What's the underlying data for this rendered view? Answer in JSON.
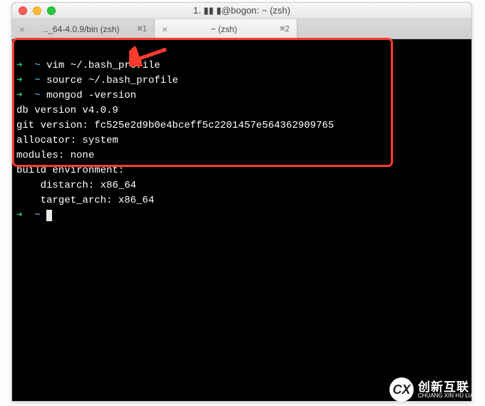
{
  "window": {
    "title": "1. ▮▮ ▮@bogon: ~ (zsh)"
  },
  "tabs": [
    {
      "title": ".._64-4.0.9/bin (zsh)",
      "shortcut": "⌘1",
      "active": false
    },
    {
      "title": "~ (zsh)",
      "shortcut": "⌘2",
      "active": true
    }
  ],
  "terminal": {
    "lines": [
      {
        "prompt": "➜",
        "tilde": "~",
        "cmd": "vim ~/.bash_profile"
      },
      {
        "prompt": "➜",
        "tilde": "~",
        "cmd": "source ~/.bash_profile"
      },
      {
        "prompt": "➜",
        "tilde": "~",
        "cmd": "mongod -version"
      }
    ],
    "output": [
      "db version v4.0.9",
      "git version: fc525e2d9b0e4bceff5c2201457e564362909765",
      "allocator: system",
      "modules: none",
      "build environment:",
      "    distarch: x86_64",
      "    target_arch: x86_64"
    ],
    "final_prompt": {
      "prompt": "➜",
      "tilde": "~"
    }
  },
  "watermark": {
    "logo": "CX",
    "cn": "创新互联",
    "en": "CHUANG XIN HU LIAN"
  }
}
